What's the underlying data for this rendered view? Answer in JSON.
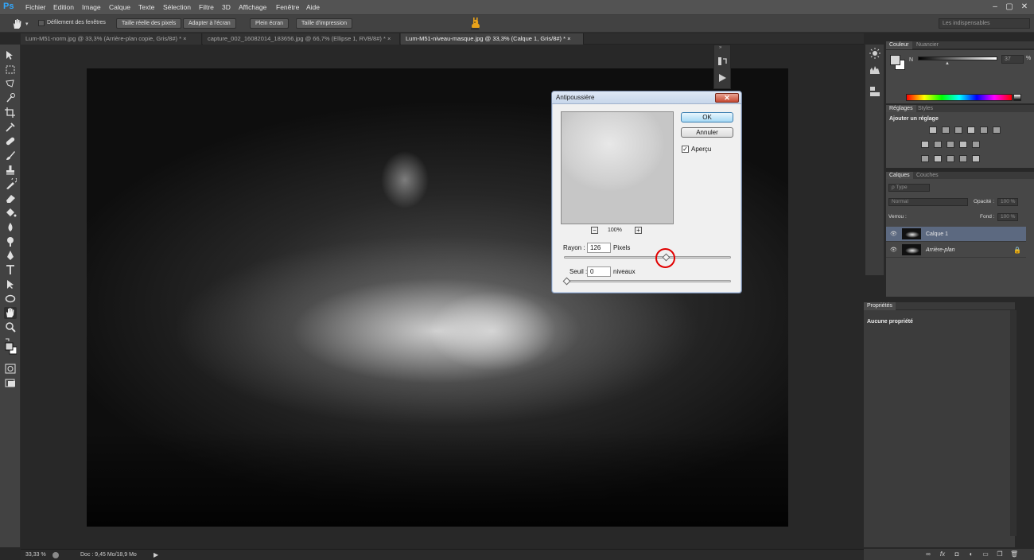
{
  "app": {
    "logo": "Ps",
    "menu": [
      "Fichier",
      "Edition",
      "Image",
      "Calque",
      "Texte",
      "Sélection",
      "Filtre",
      "3D",
      "Affichage",
      "Fenêtre",
      "Aide"
    ],
    "window_controls": [
      "–",
      "▢",
      "✕"
    ]
  },
  "options_bar": {
    "scroll_all_windows": "Défilement des fenêtres",
    "buttons": [
      "Taille réelle des pixels",
      "Adapter à l'écran",
      "Plein écran",
      "Taille d'impression"
    ],
    "workspace": "Les indispensables"
  },
  "tabs": [
    {
      "label": "Lum-M51-norm.jpg @ 33,3% (Arrière-plan copie, Gris/8#) *",
      "close": "×"
    },
    {
      "label": "capture_002_16082014_183656.jpg @ 66,7% (Ellipse 1, RVB/8#) *",
      "close": "×"
    },
    {
      "label": "Lum-M51-niveau-masque.jpg @ 33,3% (Calque 1, Gris/8#) *",
      "close": "×"
    }
  ],
  "dialog": {
    "title": "Antipoussière",
    "close": "✕",
    "ok": "OK",
    "cancel": "Annuler",
    "preview_label": "Aperçu",
    "preview_check": "✓",
    "zoom": "100%",
    "zoom_minus": "−",
    "zoom_plus": "+",
    "radius_label": "Rayon :",
    "radius_value": "126",
    "radius_unit": "Pixels",
    "radius_slider_fraction": 0.61,
    "threshold_label": "Seuil :",
    "threshold_value": "0",
    "threshold_unit": "niveaux",
    "threshold_slider_fraction": 0
  },
  "panels": {
    "color": {
      "tabs": [
        "Couleur",
        "Nuancier"
      ],
      "channel": "N",
      "value": "37",
      "unit": "%"
    },
    "adjustments": {
      "tabs": [
        "Réglages",
        "Styles"
      ],
      "title": "Ajouter un réglage"
    },
    "layers": {
      "tabs": [
        "Calques",
        "Couches"
      ],
      "filter": "ρ Type",
      "blend_mode": "Normal",
      "opacity_label": "Opacité :",
      "opacity_value": "100 %",
      "lock_label": "Verrou :",
      "fill_label": "Fond :",
      "fill_value": "100 %",
      "items": [
        {
          "name": "Calque 1",
          "selected": true
        },
        {
          "name": "Arrière-plan",
          "selected": false,
          "locked": true
        }
      ],
      "eye": "👁",
      "lock": "🔒"
    },
    "properties": {
      "tab": "Propriétés",
      "empty": "Aucune propriété"
    }
  },
  "status": {
    "zoom": "33,33 %",
    "doc": "Doc : 9,45 Mo/18,9 Mo",
    "arrow": "▶"
  },
  "colors": {
    "accent": "#31a8ff",
    "selection": "#5c6980",
    "annotation": "#e10000"
  }
}
